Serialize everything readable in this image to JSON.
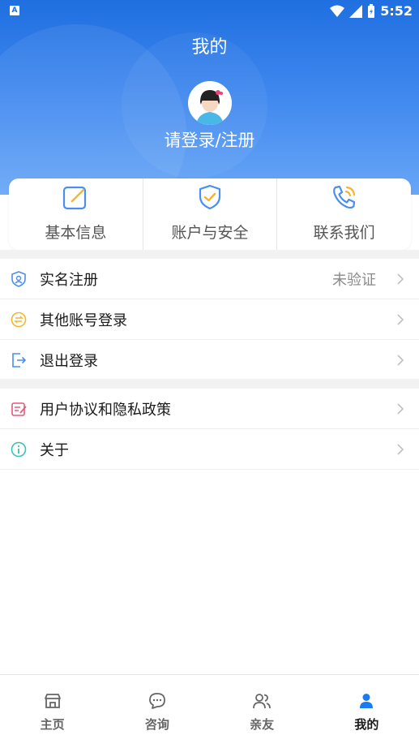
{
  "status_bar": {
    "time": "5:52",
    "notification_icon": "A"
  },
  "header": {
    "title": "我的",
    "login_text": "请登录/注册"
  },
  "quick_actions": [
    {
      "label": "基本信息",
      "icon": "edit-icon"
    },
    {
      "label": "账户与安全",
      "icon": "shield-check-icon"
    },
    {
      "label": "联系我们",
      "icon": "phone-icon"
    }
  ],
  "menu": {
    "real_name": {
      "label": "实名注册",
      "status": "未验证"
    },
    "other_login": {
      "label": "其他账号登录"
    },
    "logout": {
      "label": "退出登录"
    },
    "agreement": {
      "label": "用户协议和隐私政策"
    },
    "about": {
      "label": "关于"
    }
  },
  "bottom_nav": [
    {
      "label": "主页",
      "icon": "home-icon",
      "active": false
    },
    {
      "label": "咨询",
      "icon": "chat-icon",
      "active": false
    },
    {
      "label": "亲友",
      "icon": "friends-icon",
      "active": false
    },
    {
      "label": "我的",
      "icon": "user-icon",
      "active": true
    }
  ],
  "colors": {
    "primary": "#1f6fe0",
    "accent_icon": "#4a8ef0",
    "active_nav": "#1a7cf0"
  }
}
